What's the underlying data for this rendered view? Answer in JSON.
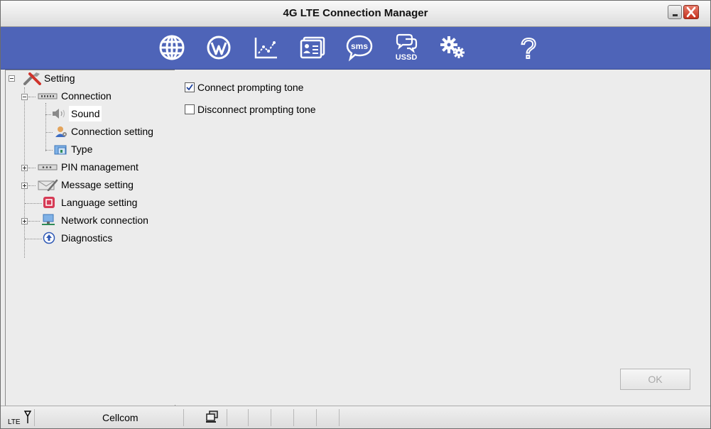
{
  "window": {
    "title": "4G LTE Connection Manager"
  },
  "toolbar": {
    "icons": [
      "globe-icon",
      "wordpress-icon",
      "statistics-chart-icon",
      "contacts-card-icon",
      "sms-icon",
      "ussd-icon",
      "settings-gears-icon",
      "help-icon"
    ],
    "sms_label": "sms",
    "ussd_label": "USSD",
    "help_label": "?"
  },
  "tree": {
    "root": "Setting",
    "connection": "Connection",
    "sound": "Sound",
    "connection_setting": "Connection setting",
    "type": "Type",
    "pin_management": "PIN management",
    "message_setting": "Message setting",
    "language_setting": "Language setting",
    "network_connection": "Network connection",
    "diagnostics": "Diagnostics"
  },
  "content": {
    "connect_tone": {
      "label": "Connect prompting tone",
      "checked": true
    },
    "disconnect_tone": {
      "label": "Disconnect prompting tone",
      "checked": false
    },
    "ok_label": "OK"
  },
  "statusbar": {
    "lte_label": "LTE",
    "operator": "Cellcom"
  },
  "colors": {
    "toolbar_bg": "#4e64b8",
    "close_button": "#c5311e",
    "checkmark": "#1b3f9b"
  }
}
